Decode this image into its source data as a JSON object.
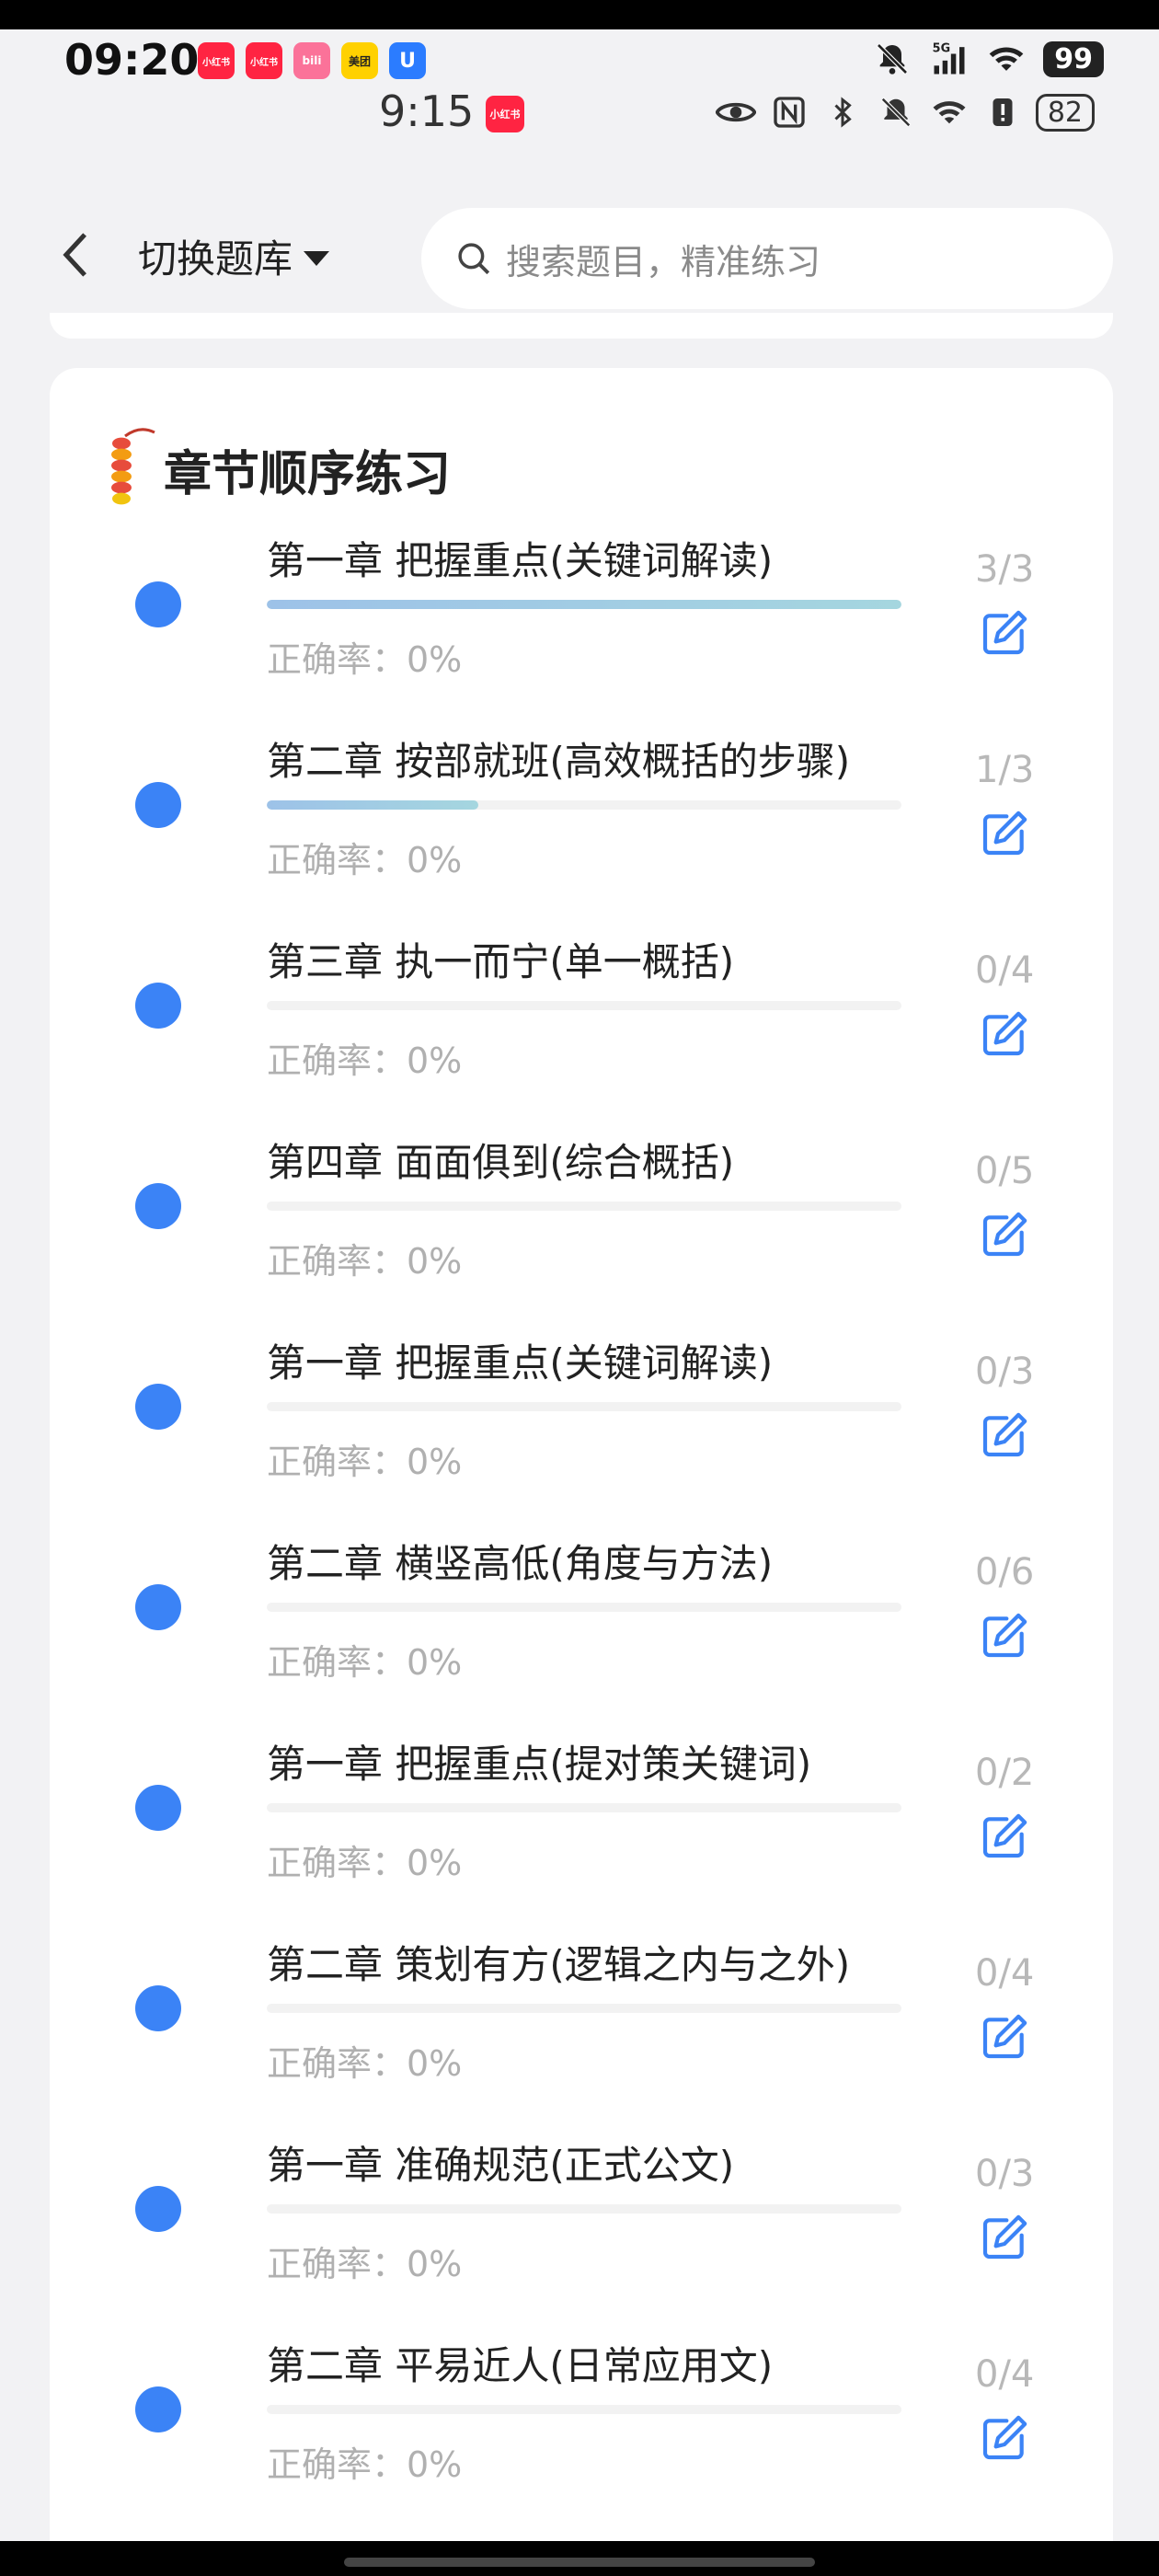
{
  "status_outer": {
    "time": "09:20",
    "app_badges": [
      {
        "label": "小红书",
        "color": "#ff2442"
      },
      {
        "label": "小红书",
        "color": "#ff2442"
      },
      {
        "label": "bili",
        "color": "#fb7299"
      },
      {
        "label": "美团",
        "color": "#ffd100"
      },
      {
        "label": "U",
        "color": "#2b7cff"
      }
    ],
    "network": "5G",
    "battery": "99"
  },
  "status_inner": {
    "time": "9:15",
    "app_badge": "小红书",
    "battery": "82"
  },
  "header": {
    "switch_label": "切换题库",
    "search_placeholder": "搜索题目，精准练习"
  },
  "section": {
    "title": "章节顺序练习"
  },
  "colors": {
    "accent": "#3b83f6",
    "progress": "#a5cfe2"
  },
  "chapters": [
    {
      "title": "第一章 把握重点(关键词解读)",
      "accuracy": "正确率：0%",
      "count": "3/3",
      "progress": 1.0
    },
    {
      "title": "第二章 按部就班(高效概括的步骤)",
      "accuracy": "正确率：0%",
      "count": "1/3",
      "progress": 0.333
    },
    {
      "title": "第三章 执一而宁(单一概括)",
      "accuracy": "正确率：0%",
      "count": "0/4",
      "progress": 0
    },
    {
      "title": "第四章 面面俱到(综合概括)",
      "accuracy": "正确率：0%",
      "count": "0/5",
      "progress": 0
    },
    {
      "title": "第一章 把握重点(关键词解读)",
      "accuracy": "正确率：0%",
      "count": "0/3",
      "progress": 0
    },
    {
      "title": "第二章 横竖高低(角度与方法)",
      "accuracy": "正确率：0%",
      "count": "0/6",
      "progress": 0
    },
    {
      "title": "第一章 把握重点(提对策关键词)",
      "accuracy": "正确率：0%",
      "count": "0/2",
      "progress": 0
    },
    {
      "title": "第二章 策划有方(逻辑之内与之外)",
      "accuracy": "正确率：0%",
      "count": "0/4",
      "progress": 0
    },
    {
      "title": "第一章 准确规范(正式公文)",
      "accuracy": "正确率：0%",
      "count": "0/3",
      "progress": 0
    },
    {
      "title": "第二章 平易近人(日常应用文)",
      "accuracy": "正确率：0%",
      "count": "0/4",
      "progress": 0
    }
  ]
}
